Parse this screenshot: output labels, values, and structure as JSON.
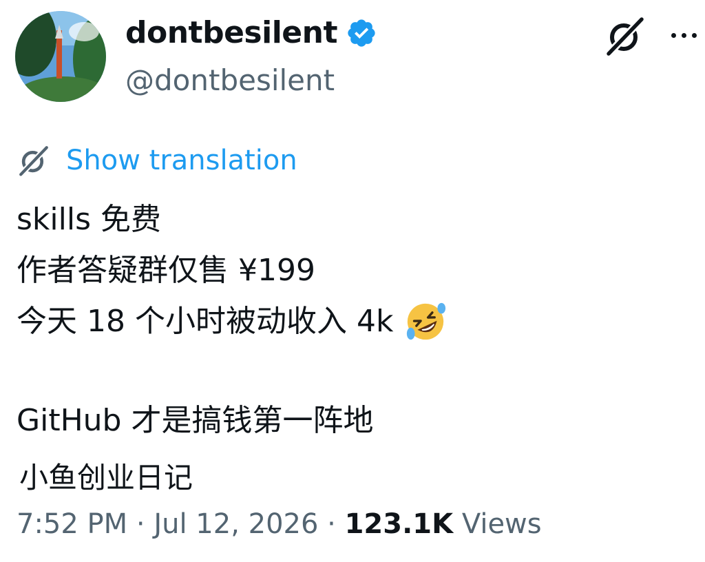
{
  "header": {
    "display_name": "dontbesilent",
    "handle": "@dontbesilent",
    "verified_icon": "verified-badge-icon",
    "grok_icon": "grok-icon",
    "more_icon": "more-horizontal-icon",
    "avatar_icon": "avatar"
  },
  "translate": {
    "icon": "grok-translate-icon",
    "label": "Show translation"
  },
  "tweet": {
    "lines": [
      "skills 免费",
      "作者答疑群仅售 ¥199",
      "今天 18 个小时被动收入 4k",
      "GitHub 才是搞钱第一阵地"
    ],
    "emoji": "rolling-on-floor-laughing-emoji"
  },
  "quoted_account": "小鱼创业日记",
  "meta": {
    "time": "7:52 PM",
    "separator": "·",
    "date": "Jul 12, 2026",
    "views_count": "123.1K",
    "views_label": "Views"
  },
  "colors": {
    "accent": "#1d9bf0",
    "text": "#0f1419",
    "secondary": "#536471"
  }
}
